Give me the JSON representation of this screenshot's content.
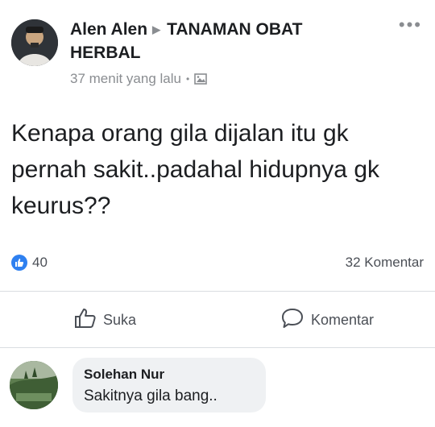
{
  "post": {
    "author": "Alen Alen",
    "group": "TANAMAN OBAT HERBAL",
    "time": "37 menit yang lalu",
    "separator": "•",
    "body": "Kenapa orang gila dijalan itu gk pernah sakit..padahal hidupnya gk keurus??",
    "likes": "40",
    "comments": "32 Komentar"
  },
  "actions": {
    "like_label": "Suka",
    "comment_label": "Komentar"
  },
  "comment": {
    "name": "Solehan Nur",
    "text": "Sakitnya gila bang.."
  },
  "colors": {
    "like_blue": "#2e80f0",
    "meta_gray": "#8a8d91",
    "bubble_bg": "#eff1f3"
  },
  "icons": {
    "more": "more-options-icon",
    "privacy": "public-photo-icon",
    "like": "thumbs-up-icon",
    "comment": "speech-bubble-icon"
  }
}
